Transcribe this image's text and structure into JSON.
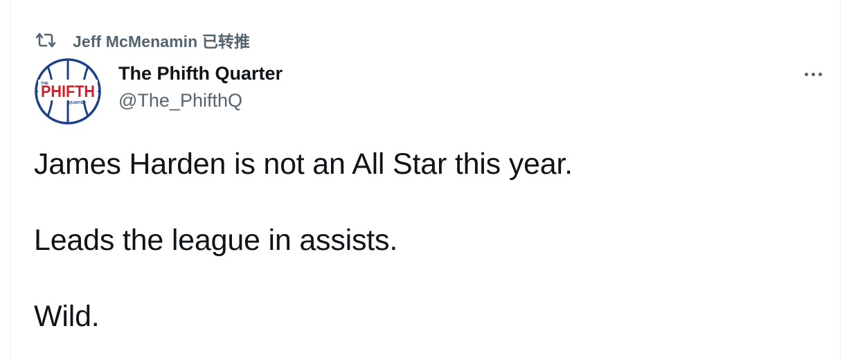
{
  "retweet": {
    "text": "Jeff McMenamin 已转推",
    "icon": "retweet-icon"
  },
  "author": {
    "name": "The Phifth Quarter",
    "handle": "@The_PhifthQ",
    "avatar_text": "PHIFTH",
    "avatar_small_top": "THE",
    "avatar_small_bottom": "QUARTER"
  },
  "more_icon": "more-dots-icon",
  "tweet": {
    "lines": [
      "James Harden is not an All Star this year.",
      "Leads the league in assists.",
      "Wild."
    ]
  },
  "colors": {
    "text": "#0f1419",
    "secondary": "#536471",
    "logo_blue": "#1d3f8b",
    "logo_red": "#d0202e"
  }
}
